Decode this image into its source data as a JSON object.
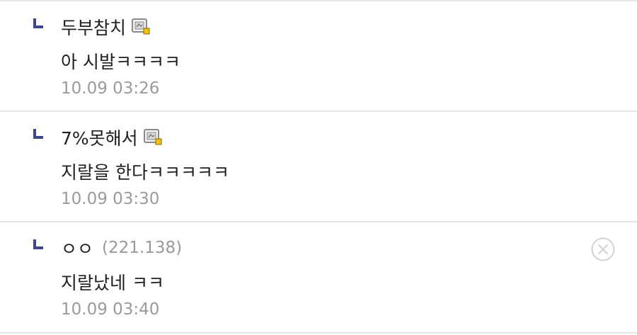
{
  "comments": [
    {
      "nickname": "두부참치",
      "has_gallog_icon": true,
      "ip": "",
      "content": "아 시발ㅋㅋㅋㅋ",
      "date": "10.09 03:26",
      "deletable": false
    },
    {
      "nickname": "7%못해서",
      "has_gallog_icon": true,
      "ip": "",
      "content": "지랄을 한다ㅋㅋㅋㅋㅋ",
      "date": "10.09 03:30",
      "deletable": false
    },
    {
      "nickname": "ㅇㅇ",
      "has_gallog_icon": false,
      "ip": "(221.138)",
      "content": "지랄났네 ㅋㅋ",
      "date": "10.09 03:40",
      "deletable": true
    }
  ],
  "icons": {
    "reply_mark": "reply-arrow-icon",
    "gallog": "gallog-icon",
    "delete": "close-circle-icon"
  },
  "colors": {
    "reply_mark": "#3b4890",
    "nickname": "#1f1f1f",
    "meta_gray": "#9b9b9b",
    "divider": "#e4e4ea",
    "gallog_badge": "#f2c200"
  }
}
